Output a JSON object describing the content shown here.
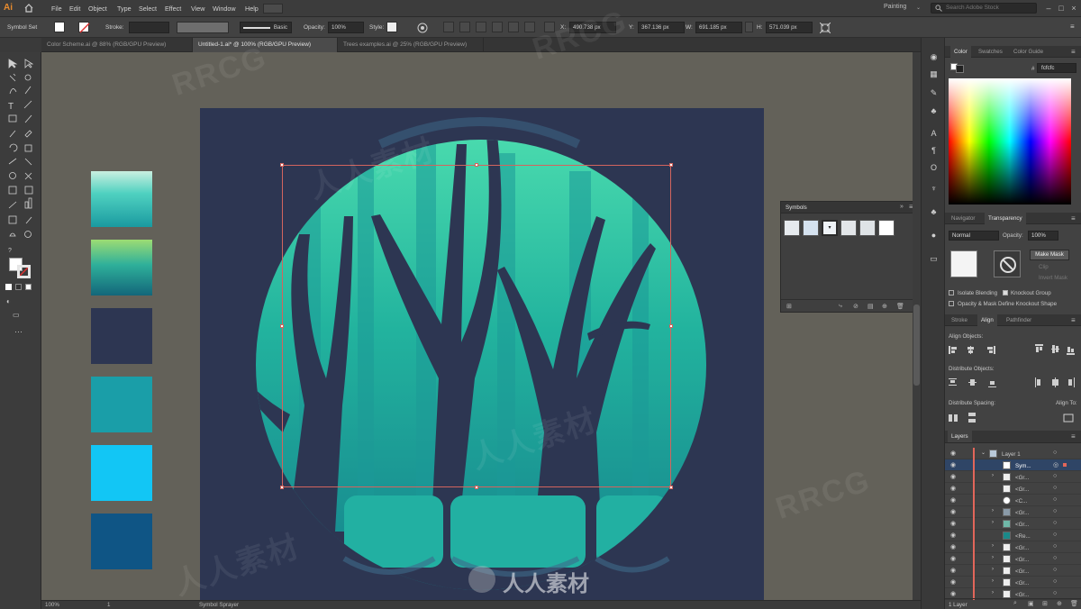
{
  "menubar": {
    "logo": "Ai",
    "items": [
      "File",
      "Edit",
      "Object",
      "Type",
      "Select",
      "Effect",
      "View",
      "Window",
      "Help"
    ],
    "workspace": "Painting",
    "search_placeholder": "Search Adobe Stock"
  },
  "control_bar": {
    "selection_label": "Symbol Set",
    "stroke_label": "Stroke:",
    "brush_style": "Basic",
    "opacity_label": "Opacity:",
    "opacity_value": "100%",
    "style_label": "Style:",
    "x_label": "X:",
    "x_value": "490.738 px",
    "y_label": "Y:",
    "y_value": "367.136 px",
    "w_label": "W:",
    "w_value": "691.185 px",
    "h_label": "H:",
    "h_value": "571.039 px"
  },
  "doc_tabs": [
    {
      "label": "Color Scheme.ai @ 88% (RGB/GPU Preview)",
      "active": false
    },
    {
      "label": "Untitled-1.ai* @ 100% (RGB/GPU Preview)",
      "active": true
    },
    {
      "label": "Trees examples.ai @ 25% (RGB/GPU Preview)",
      "active": false
    }
  ],
  "swatches": [
    "#1fb0a6",
    "#1a8a8a",
    "#2d3652",
    "#1a9ea8",
    "#12c6f5",
    "#0f5585"
  ],
  "symbols_panel": {
    "title": "Symbols"
  },
  "color_panel": {
    "tabs": [
      "Color",
      "Swatches",
      "Color Guide"
    ],
    "hex_label": "#",
    "hex_value": "fcfcfc"
  },
  "transparency_panel": {
    "tabs": [
      "Navigator",
      "Transparency"
    ],
    "blend_mode": "Normal",
    "opacity_label": "Opacity:",
    "opacity_value": "100%",
    "make_mask": "Make Mask",
    "clip": "Clip",
    "invert_mask": "Invert Mask",
    "isolate_blending": "Isolate Blending",
    "knockout_group": "Knockout Group",
    "opacity_mask": "Opacity & Mask Define Knockout Shape"
  },
  "align_panel": {
    "tabs": [
      "Stroke",
      "Align",
      "Pathfinder"
    ],
    "align_objects": "Align Objects:",
    "distribute_objects": "Distribute Objects:",
    "distribute_spacing": "Distribute Spacing:",
    "align_to": "Align To:"
  },
  "layers_panel": {
    "title": "Layers",
    "rows": [
      "Layer 1",
      "Sym...",
      "<Gr...",
      "<Gr...",
      "<C...",
      "<Gr...",
      "<Gr...",
      "<Re...",
      "<Gr...",
      "<Gr...",
      "<Gr...",
      "<Gr...",
      "<Gr..."
    ],
    "count": "1 Layer"
  },
  "status_bar": {
    "zoom": "100%",
    "artboard": "1",
    "tool": "Symbol Sprayer"
  },
  "watermarks": [
    "RRCG",
    "人人素材",
    "RRCG",
    "人人素材",
    "RRCG",
    "人人素材"
  ],
  "brand_mark": "人人素材"
}
